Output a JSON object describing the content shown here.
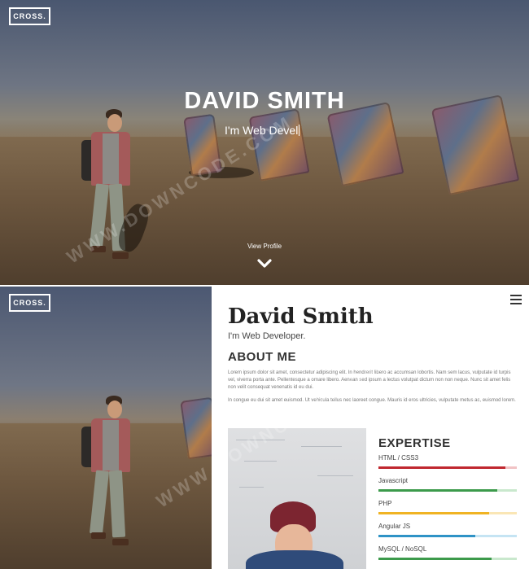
{
  "brand": {
    "logo": "CROSS."
  },
  "hero": {
    "title": "DAVID SMITH",
    "subtitle": "I'm Web Devel",
    "cta": "View Profile",
    "cta_icon": "chevron-down-icon"
  },
  "sidebar_logo": "CROSS.",
  "profile": {
    "name": "David Smith",
    "role": "I'm Web Developer.",
    "menu_icon": "hamburger-menu-icon",
    "about": {
      "title": "ABOUT ME",
      "paragraph1": "Lorem ipsum dolor sit amet, consectetur adipiscing elit. In hendrerit libero ac accumsan lobortis. Nam sem lacus, vulputate id turpis vel, viverra porta ante. Pellentesque a ornare libero. Aenean sed ipsum a lectus volutpat dictum non non neque. Nunc sit amet felis non velit consequat venenatis id eu dui.",
      "paragraph2": "In congue eu dui sit amet euismod. Ut vehicula tellus nec laoreet congue. Mauris id eros ultricies, vulputate metus ac, euismod lorem."
    },
    "expertise": {
      "title": "EXPERTISE",
      "skills": [
        {
          "label": "HTML / CSS3",
          "level": 0.92,
          "color": "#c0282f",
          "track": "#f1c3c5"
        },
        {
          "label": "Javascript",
          "level": 0.86,
          "color": "#3c9a4b",
          "track": "#c9e8cd"
        },
        {
          "label": "PHP",
          "level": 0.8,
          "color": "#f0b323",
          "track": "#fae6b5"
        },
        {
          "label": "Angular JS",
          "level": 0.7,
          "color": "#2f93c6",
          "track": "#c5e4f3"
        },
        {
          "label": "MySQL / NoSQL",
          "level": 0.82,
          "color": "#3c9a4b",
          "track": "#c9e8cd"
        }
      ]
    }
  },
  "watermark": "WWW.DOWNCODE.COM"
}
